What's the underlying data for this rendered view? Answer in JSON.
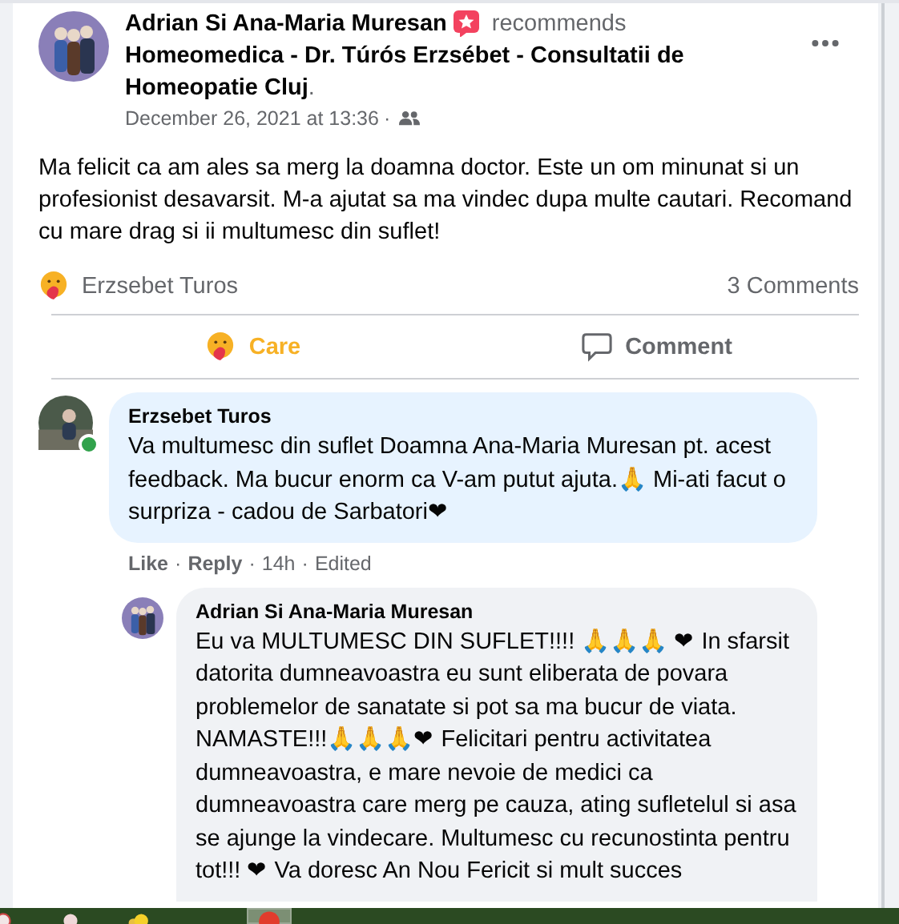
{
  "post": {
    "author": "Adrian Si Ana-Maria Muresan",
    "action": "recommends",
    "page": "Homeomedica - Dr. Túrós Erzsébet - Consultatii de Homeopatie Cluj",
    "page_end": ".",
    "date": "December 26, 2021 at 13:36",
    "date_sep": "·",
    "text": "Ma felicit ca am ales sa merg la doamna doctor. Este un om minunat si un profesionist desavarsit. M-a ajutat sa ma vindec dupa multe cautari. Recomand cu mare drag si ii multumesc din suflet!"
  },
  "reactions": {
    "names": "Erzsebet Turos",
    "comments": "3 Comments"
  },
  "actions": [
    {
      "label": "Care",
      "kind": "care",
      "selected": true
    },
    {
      "label": "Comment",
      "kind": "comment",
      "selected": false
    }
  ],
  "comments": [
    {
      "author": "Erzsebet Turos",
      "online": true,
      "color": "#e7f3ff",
      "text": "Va multumesc din suflet Doamna Ana-Maria Muresan pt. acest feedback. Ma bucur enorm ca V-am putut ajuta.🙏 Mi-ati facut o surpriza - cadou de Sarbatori❤",
      "separator": "·",
      "links": [
        "Like",
        "Reply"
      ],
      "time": "14h",
      "edited": "Edited",
      "children": [
        {
          "author": "Adrian Si Ana-Maria Muresan",
          "online": false,
          "color": "#f0f2f5",
          "text": "Eu va MULTUMESC DIN SUFLET!!!! 🙏🙏🙏 ❤ In sfarsit datorita dumneavoastra eu sunt eliberata de povara problemelor de sanatate si pot sa ma bucur de viata. NAMASTE!!!🙏🙏🙏❤ Felicitari pentru activitatea dumneavoastra, e mare nevoie de medici ca dumneavoastra care merg pe cauza, ating sufletelul si asa se ajunge la vindecare. Multumesc cu recunostinta pentru tot!!! ❤ Va doresc An Nou Fericit si mult succes"
        }
      ]
    }
  ]
}
